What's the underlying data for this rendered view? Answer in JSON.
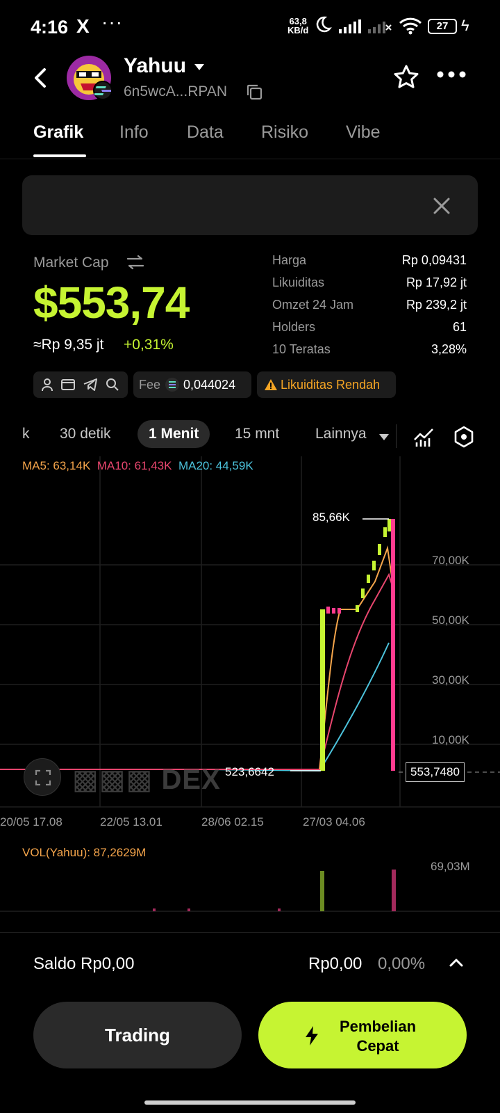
{
  "status_bar": {
    "time": "4:16",
    "x_icon": "X",
    "dots": "···",
    "speed_value": "63,8",
    "speed_unit": "KB/d",
    "battery": "27"
  },
  "header": {
    "token_name": "Yahuu",
    "address": "6n5wcA...RPAN"
  },
  "tabs": [
    "Grafik",
    "Info",
    "Data",
    "Risiko",
    "Vibe"
  ],
  "market": {
    "label": "Market Cap",
    "value": "$553,74",
    "idr": "≈Rp 9,35 jt",
    "change": "+0,31%",
    "stats": [
      {
        "label": "Harga",
        "value": "Rp 0,09431"
      },
      {
        "label": "Likuiditas",
        "value": "Rp 17,92 jt"
      },
      {
        "label": "Omzet 24 Jam",
        "value": "Rp 239,2 jt"
      },
      {
        "label": "Holders",
        "value": "61"
      },
      {
        "label": "10 Teratas",
        "value": "3,28%"
      }
    ]
  },
  "chips": {
    "fee_label": "Fee",
    "fee_value": "0,044024",
    "liquidity_warning": "Likuiditas Rendah"
  },
  "intervals": {
    "partial": "k",
    "items": [
      "30 detik",
      "1 Menit",
      "15 mnt",
      "Lainnya"
    ],
    "active": "1 Menit"
  },
  "chart": {
    "ma5": "MA5: 63,14K",
    "ma10": "MA10: 61,43K",
    "ma20": "MA20: 44,59K",
    "y_ticks": [
      "70,00K",
      "50,00K",
      "30,00K",
      "10,00K"
    ],
    "x_ticks": [
      "20/05 17.08",
      "22/05 13.01",
      "28/06 02.15",
      "27/03 04.06"
    ],
    "high_label": "85,66K",
    "low_label": "523,6642",
    "current_label": "553,7480",
    "watermark": "DEX",
    "volume_label": "VOL(Yahuu): 87,2629M",
    "volume_max": "69,03M",
    "colors": {
      "up": "#c6f432",
      "down": "#ff3b8e",
      "ma5": "#f5a54b",
      "ma10": "#e8466e",
      "ma20": "#4cc3dc"
    }
  },
  "chart_data": {
    "type": "line",
    "title": "",
    "y_ticks": [
      "70,00K",
      "50,00K",
      "30,00K",
      "10,00K"
    ],
    "x_ticks": [
      "20/05 17.08",
      "22/05 13.01",
      "28/06 02.15",
      "27/03 04.06"
    ],
    "series": [
      {
        "name": "MA5",
        "values": [
          63140
        ]
      },
      {
        "name": "MA10",
        "values": [
          61430
        ]
      },
      {
        "name": "MA20",
        "values": [
          44590
        ]
      }
    ],
    "high": 85660,
    "low": 523.6642,
    "current": 553.748,
    "volume_max": 69030000
  },
  "bottom": {
    "saldo": "Saldo Rp0,00",
    "saldo_rp": "Rp0,00",
    "saldo_pct": "0,00%",
    "trade_button": "Trading",
    "quick_buy_button": "Pembelian Cepat"
  }
}
